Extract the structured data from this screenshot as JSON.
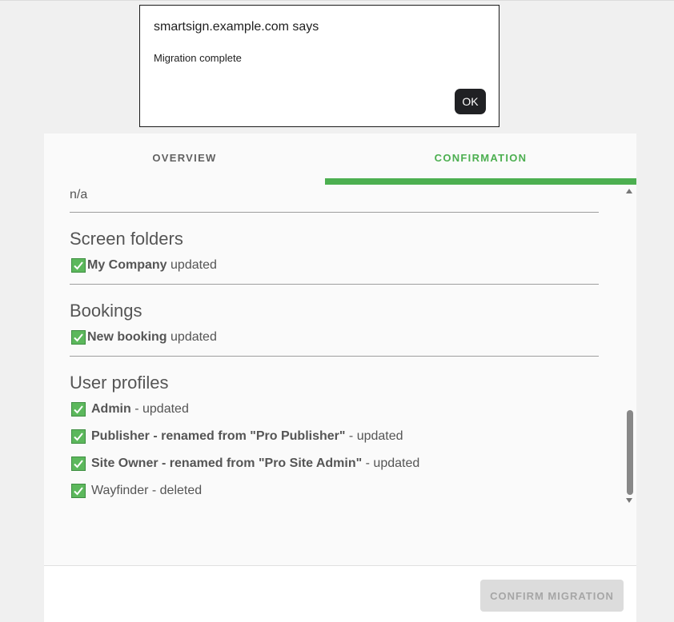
{
  "dialog": {
    "title": "smartsign.example.com says",
    "message": "Migration complete",
    "ok_label": "OK"
  },
  "tabs": {
    "overview": "OVERVIEW",
    "confirmation": "CONFIRMATION",
    "active": "confirmation"
  },
  "content": {
    "top_value": "n/a",
    "screen_folders": {
      "title": "Screen folders",
      "items": [
        {
          "name": "My Company",
          "status": "updated"
        }
      ]
    },
    "bookings": {
      "title": "Bookings",
      "items": [
        {
          "name": "New booking",
          "status": "updated"
        }
      ]
    },
    "user_profiles": {
      "title": "User profiles",
      "items": [
        {
          "name": "Admin",
          "status": "- updated"
        },
        {
          "name": "Publisher - renamed from \"Pro Publisher\"",
          "status": "- updated"
        },
        {
          "name": "Site Owner - renamed from \"Pro Site Admin\"",
          "status": "- updated"
        },
        {
          "text": "Wayfinder - deleted"
        }
      ]
    }
  },
  "footer": {
    "confirm_label": "CONFIRM MIGRATION",
    "confirm_enabled": false
  },
  "colors": {
    "accent": "#4caf50",
    "check_bg": "#5cb85c",
    "dialog_button": "#202124"
  },
  "icons": {
    "check": "checkbox-checked-icon"
  }
}
